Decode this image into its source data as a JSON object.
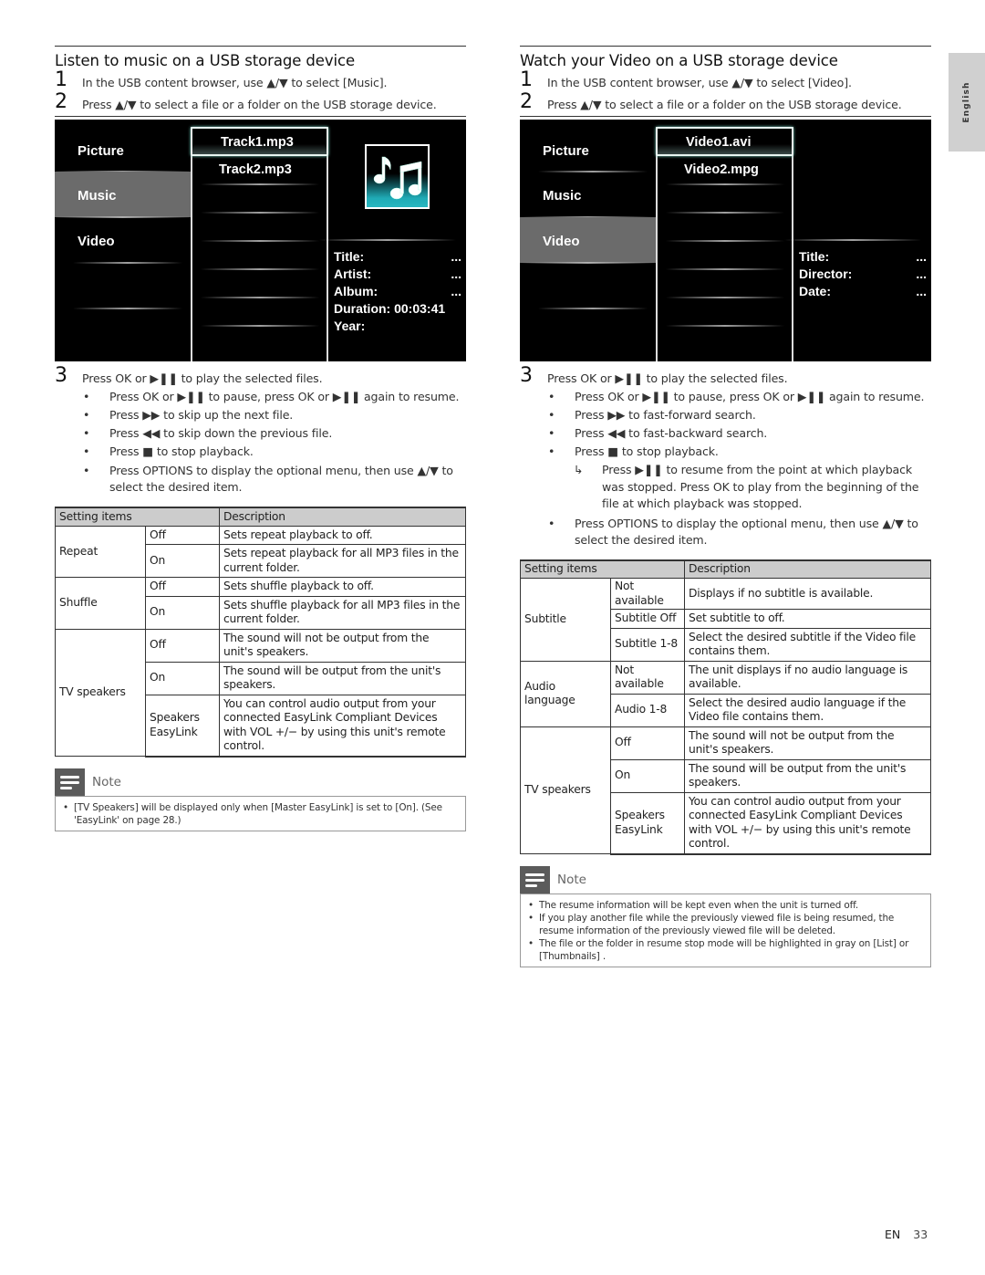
{
  "language_tab": "English",
  "footer": {
    "lang": "EN",
    "page": "33"
  },
  "music_section": {
    "title": "Listen to music on a USB storage device",
    "step1": {
      "num": "1",
      "text": "In the USB content browser, use ▲/▼ to select [Music]."
    },
    "step2": {
      "num": "2",
      "text": "Press ▲/▼ to select a file or a folder on the USB storage device."
    },
    "screen": {
      "categories": [
        "Picture",
        "Music",
        "Video"
      ],
      "selected_category": "Music",
      "files": [
        "Track1.mp3",
        "Track2.mp3"
      ],
      "selected_file": "Track1.mp3",
      "thumbnail_icon": "music-notes-icon",
      "info": [
        {
          "label": "Title:",
          "value": "..."
        },
        {
          "label": "Artist:",
          "value": "..."
        },
        {
          "label": "Album:",
          "value": "..."
        },
        {
          "label": "Duration: 00:03:41",
          "value": ""
        },
        {
          "label": "Year:",
          "value": ""
        }
      ]
    },
    "step3": {
      "num": "3",
      "text": "Press OK or ▶❚❚ to play the selected files."
    },
    "bullets": [
      "Press OK or ▶❚❚ to pause, press OK or ▶❚❚ again to resume.",
      "Press ▶▶ to skip up the next file.",
      "Press ◀◀ to skip down the previous file.",
      "Press ■ to stop playback.",
      "Press OPTIONS to display the optional menu, then use ▲/▼ to select the desired item."
    ],
    "table": {
      "headers": [
        "Setting items",
        "Description"
      ],
      "groups": [
        {
          "item": "Repeat",
          "rows": [
            {
              "option": "Off",
              "desc": "Sets repeat playback to off."
            },
            {
              "option": "On",
              "desc": "Sets repeat playback for all MP3 files in the current folder."
            }
          ]
        },
        {
          "item": "Shuffle",
          "rows": [
            {
              "option": "Off",
              "desc": "Sets shuffle playback to off."
            },
            {
              "option": "On",
              "desc": "Sets shuffle playback for all MP3 files in the current folder."
            }
          ]
        },
        {
          "item": "TV speakers",
          "rows": [
            {
              "option": "Off",
              "desc": "The sound will not be output from the unit's speakers."
            },
            {
              "option": "On",
              "desc": "The sound will be output from the unit's speakers."
            },
            {
              "option": "Speakers EasyLink",
              "desc": "You can control audio output from your connected EasyLink Compliant Devices with VOL +/− by using this unit's remote control."
            }
          ]
        }
      ]
    },
    "note": {
      "title": "Note",
      "items": [
        "[TV Speakers] will be displayed only when [Master EasyLink] is set to [On]. (See 'EasyLink' on page 28.)"
      ]
    }
  },
  "video_section": {
    "title": "Watch your Video on a USB storage device",
    "step1": {
      "num": "1",
      "text": "In the USB content browser, use ▲/▼ to select [Video]."
    },
    "step2": {
      "num": "2",
      "text": "Press ▲/▼ to select a file or a folder on the USB storage device."
    },
    "screen": {
      "categories": [
        "Picture",
        "Music",
        "Video"
      ],
      "selected_category": "Video",
      "files": [
        "Video1.avi",
        "Video2.mpg"
      ],
      "selected_file": "Video1.avi",
      "info": [
        {
          "label": "Title:",
          "value": "..."
        },
        {
          "label": "Director:",
          "value": "..."
        },
        {
          "label": "Date:",
          "value": "..."
        }
      ]
    },
    "step3": {
      "num": "3",
      "text": "Press OK or ▶❚❚ to play the selected files."
    },
    "bullets": [
      "Press OK or ▶❚❚ to pause, press OK or ▶❚❚ again to resume.",
      "Press ▶▶ to fast-forward search.",
      "Press ◀◀ to fast-backward search.",
      "Press ■ to stop playback."
    ],
    "sub_bullet": {
      "arrow": "↳",
      "text": "Press ▶❚❚ to resume from the point at which playback was stopped. Press OK to play from the beginning of the file at which playback was stopped."
    },
    "bullet_last": "Press OPTIONS to display the optional menu, then use ▲/▼ to select the desired item.",
    "table": {
      "headers": [
        "Setting items",
        "Description"
      ],
      "groups": [
        {
          "item": "Subtitle",
          "rows": [
            {
              "option": "Not available",
              "desc": "Displays if no subtitle is available."
            },
            {
              "option": "Subtitle Off",
              "desc": "Set subtitle to off."
            },
            {
              "option": "Subtitle 1-8",
              "desc": "Select the desired subtitle if the Video file contains them."
            }
          ]
        },
        {
          "item": "Audio language",
          "rows": [
            {
              "option": "Not available",
              "desc": "The unit displays if no audio language is available."
            },
            {
              "option": "Audio 1-8",
              "desc": "Select the desired audio language if the Video file contains them."
            }
          ]
        },
        {
          "item": "TV speakers",
          "rows": [
            {
              "option": "Off",
              "desc": "The sound will not be output from the unit's speakers."
            },
            {
              "option": "On",
              "desc": "The sound will be output from the unit's speakers."
            },
            {
              "option": "Speakers EasyLink",
              "desc": "You can control audio output from your connected EasyLink Compliant Devices with VOL +/− by using this unit's remote control."
            }
          ]
        }
      ]
    },
    "note": {
      "title": "Note",
      "items": [
        "The resume information will be kept even when the unit is turned off.",
        "If you play another file while the previously viewed file is being resumed, the resume information of the previously viewed file will be deleted.",
        "The file or the folder in resume stop mode will be highlighted in gray on [List] or [Thumbnails] ."
      ]
    }
  }
}
